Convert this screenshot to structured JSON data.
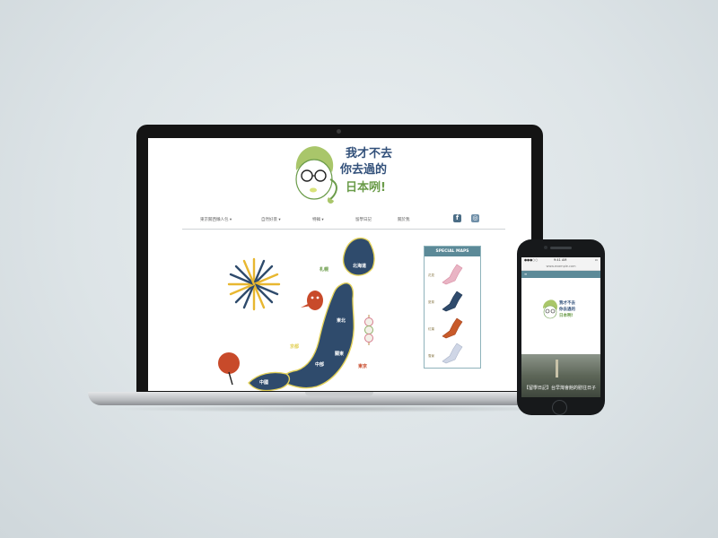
{
  "site": {
    "logo": {
      "line1": "我才不去",
      "line2": "你去過的",
      "line3": "日本咧!"
    },
    "nav": [
      {
        "label": "東京關西懶人包 ▾"
      },
      {
        "label": "自然好景 ▾"
      },
      {
        "label": "特輯 ▾"
      },
      {
        "label": "留學日記"
      },
      {
        "label": "關於我"
      }
    ],
    "social": {
      "facebook_icon": "f",
      "instagram_icon": "◎"
    },
    "map_labels": {
      "sapporo": "札幌",
      "hokkaido": "北海道",
      "tohoku": "東北",
      "kyoto": "京都",
      "chubu": "中部",
      "kanto": "關東",
      "tokyo": "東京",
      "chugoku": "中國"
    },
    "sidebar": {
      "title": "SPECIAL MAPS",
      "maps": [
        {
          "label": "花見",
          "color": "#e9b4c4"
        },
        {
          "label": "夏祭",
          "color": "#2f4b6c"
        },
        {
          "label": "紅葉",
          "color": "#c85a2a"
        },
        {
          "label": "雪景",
          "color": "#cfd6e6"
        }
      ]
    }
  },
  "phone": {
    "status": {
      "carrier": "●●●○○",
      "time": "9:41 AM",
      "battery": "▭"
    },
    "url": "www.example.com",
    "menu_icon": "≡",
    "logo_lines": [
      "我才不去",
      "你去過的",
      "日本咧!"
    ],
    "article_title": "【留學日記】台早灣會館的慰往日子"
  },
  "colors": {
    "navy": "#2f4b6c",
    "teal": "#5c8a98",
    "olive": "#6b9c4a",
    "accent_red": "#c84a2a"
  }
}
